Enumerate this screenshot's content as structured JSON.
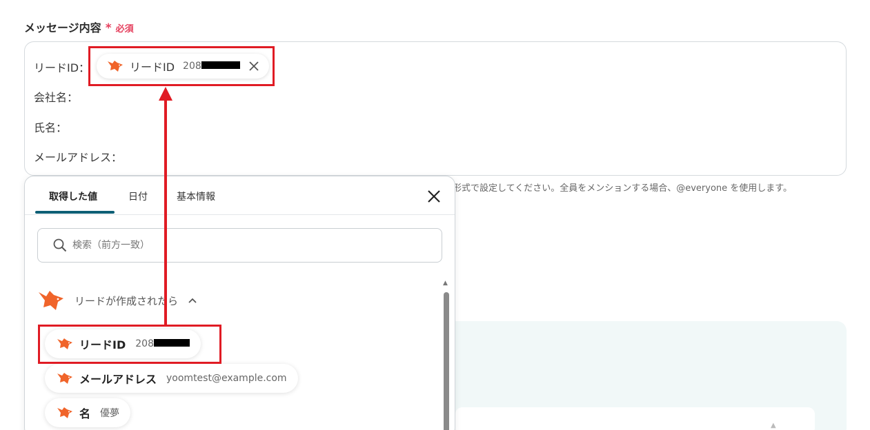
{
  "field": {
    "label": "メッセージ内容",
    "required_mark": "*",
    "required_text": "必須"
  },
  "message": {
    "lines": [
      "リードID：",
      "会社名：",
      "氏名：",
      "メールアドレス："
    ],
    "inserted_pill": {
      "name": "リードID",
      "value": "208",
      "icon": "fox-icon",
      "remove_icon": "close-icon"
    }
  },
  "hint": "形式で設定してください。全員をメンションする場合、@everyone を使用します。",
  "popup": {
    "tabs": [
      "取得した値",
      "日付",
      "基本情報"
    ],
    "active_tab": "取得した値",
    "close_icon": "close-icon",
    "search": {
      "placeholder": "検索（前方一致）",
      "value": "",
      "icon": "search-icon"
    },
    "group": {
      "title": "リードが作成されたら",
      "icon": "fox-icon",
      "expanded": true
    },
    "items": [
      {
        "name": "リードID",
        "value": "208"
      },
      {
        "name": "メールアドレス",
        "value": "yoomtest@example.com"
      },
      {
        "name": "名",
        "value": "優夢"
      }
    ]
  },
  "colors": {
    "accent_tab": "#0d5f75",
    "required": "#e5405e",
    "annotation": "#e01b24",
    "fox_orange": "#f0642a",
    "panel_bg": "#f1f8f8"
  }
}
